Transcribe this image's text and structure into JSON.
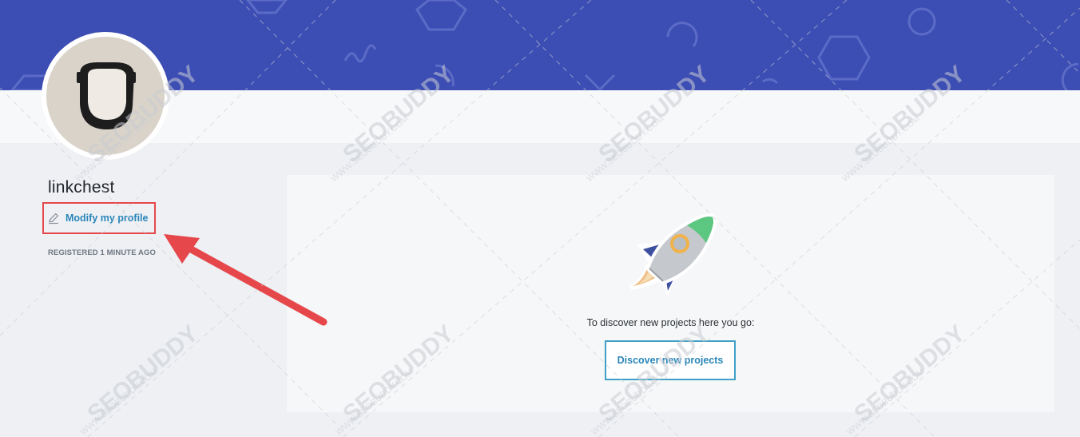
{
  "profile": {
    "username": "linkchest",
    "modify_label": "Modify my profile",
    "registered": "REGISTERED 1 MINUTE AGO"
  },
  "projects": {
    "empty_message": "To discover new projects here you go:",
    "discover_label": "Discover new projects"
  },
  "watermark": {
    "brand": "SEOBUDDY",
    "site": "WWW.SEOBUDDY.COM"
  },
  "icons": {
    "edit": "pencil-icon",
    "rocket": "rocket-illustration",
    "annotation": "red-arrow"
  },
  "colors": {
    "banner": "#3c4db4",
    "link": "#2a86b9",
    "highlight": "#e5474b",
    "button_border": "#3ea0c6"
  }
}
